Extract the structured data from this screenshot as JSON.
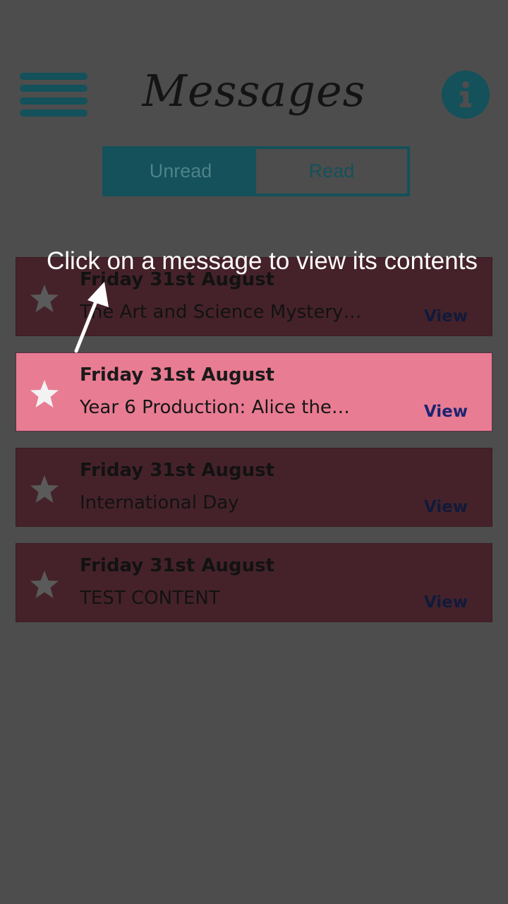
{
  "header": {
    "title": "Messages",
    "menu_icon": "hamburger-menu-icon",
    "info_icon": "info-icon",
    "accent_color": "#14515a"
  },
  "tabs": [
    {
      "label": "Unread",
      "selected": true
    },
    {
      "label": "Read",
      "selected": false
    }
  ],
  "tooltip": {
    "text": "Click on a message to view its contents",
    "pointer_icon": "arrow-up-icon"
  },
  "messages": [
    {
      "date": "Friday 31st August",
      "subject": "The Art and Science Mystery…",
      "action": "View",
      "highlighted": false
    },
    {
      "date": "Friday 31st August",
      "subject": "Year 6 Production: Alice the…",
      "action": "View",
      "highlighted": true
    },
    {
      "date": "Friday 31st August",
      "subject": "International Day",
      "action": "View",
      "highlighted": false
    },
    {
      "date": "Friday 31st August",
      "subject": "TEST CONTENT",
      "action": "View",
      "highlighted": false
    }
  ],
  "colors": {
    "overlay_background": "#4d4d4d",
    "row_dimmed": "#45222a",
    "row_highlight": "#e87c93",
    "view_link": "#1c2470"
  }
}
